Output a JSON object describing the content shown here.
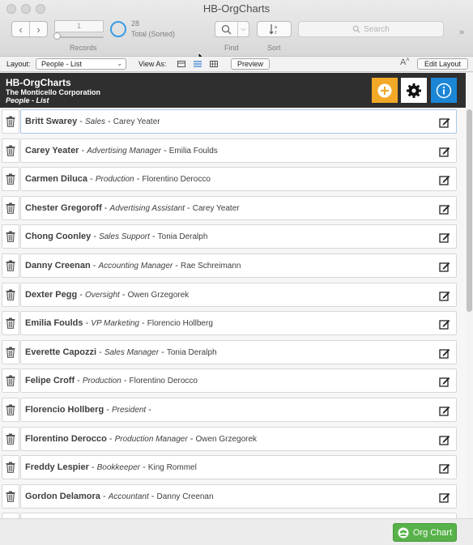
{
  "window": {
    "title": "HB-OrgCharts"
  },
  "toolbar": {
    "record_value": "1",
    "records_label": "Records",
    "count": "28",
    "total_label": "Total (Sorted)",
    "find_label": "Find",
    "sort_label": "Sort",
    "search_placeholder": "Search"
  },
  "layoutbar": {
    "layout_label": "Layout:",
    "layout_value": "People - List",
    "view_as_label": "View As:",
    "preview_label": "Preview",
    "edit_layout_label": "Edit Layout"
  },
  "header": {
    "app_title": "HB-OrgCharts",
    "company": "The Monticello Corporation",
    "layout_name": "People - List"
  },
  "people": [
    {
      "name": "Britt Swarey",
      "title": "Sales",
      "manager": "Carey Yeater"
    },
    {
      "name": "Carey Yeater",
      "title": "Advertising Manager",
      "manager": "Emilia Foulds"
    },
    {
      "name": "Carmen Diluca",
      "title": "Production",
      "manager": "Florentino Derocco"
    },
    {
      "name": "Chester Gregoroff",
      "title": "Advertising Assistant",
      "manager": "Carey Yeater"
    },
    {
      "name": "Chong Coonley",
      "title": "Sales Support",
      "manager": "Tonia Deralph"
    },
    {
      "name": "Danny Creenan",
      "title": "Accounting Manager",
      "manager": "Rae Schreimann"
    },
    {
      "name": "Dexter Pegg",
      "title": "Oversight",
      "manager": "Owen Grzegorek"
    },
    {
      "name": "Emilia Foulds",
      "title": "VP Marketing",
      "manager": "Florencio Hollberg"
    },
    {
      "name": "Everette Capozzi",
      "title": "Sales Manager",
      "manager": "Tonia Deralph"
    },
    {
      "name": "Felipe Croff",
      "title": "Production",
      "manager": "Florentino Derocco"
    },
    {
      "name": "Florencio Hollberg",
      "title": "President",
      "manager": ""
    },
    {
      "name": "Florentino Derocco",
      "title": "Production Manager",
      "manager": "Owen Grzegorek"
    },
    {
      "name": "Freddy Lespier",
      "title": "Bookkeeper",
      "manager": "King Rommel"
    },
    {
      "name": "Gordon Delamora",
      "title": "Accountant",
      "manager": "Danny Creenan"
    }
  ],
  "footer": {
    "org_chart_label": "Org Chart"
  },
  "colors": {
    "add_button": "#f2a928",
    "info_button": "#1b86d6",
    "org_chart_button": "#58b24a",
    "header_band": "#2f2f2f",
    "progress_ring": "#3a9ce5"
  }
}
